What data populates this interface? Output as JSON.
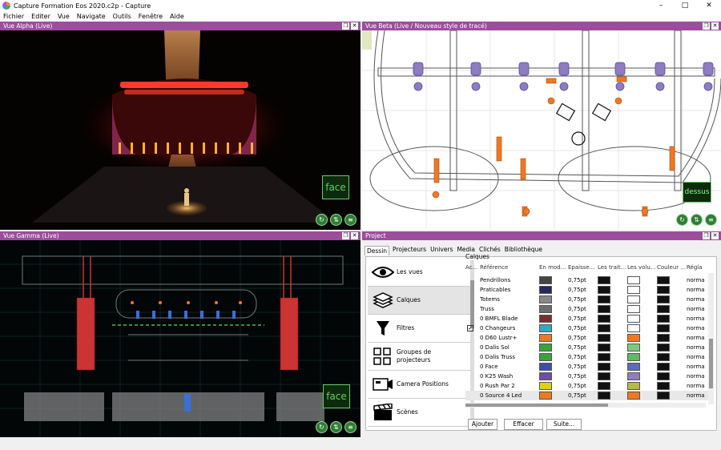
{
  "window": {
    "title": "Capture Formation Eos 2020.c2p - Capture",
    "minimize": "–",
    "maximize": "□",
    "close": "✕"
  },
  "menu": [
    "Fichier",
    "Editer",
    "Vue",
    "Navigate",
    "Outils",
    "Fenêtre",
    "Aide"
  ],
  "panes": {
    "alpha": {
      "title": "Vue Alpha  (Live)",
      "label": "face"
    },
    "beta": {
      "title": "Vue Beta  (Live / Nouveau style de tracé)",
      "label": "dessus"
    },
    "gamma": {
      "title": "Vue Gamma  (Live)",
      "label": "face"
    },
    "project": {
      "title": "Project"
    }
  },
  "pane_buttons": {
    "a": "❐",
    "b": "✕"
  },
  "view_buttons": {
    "a": "↻",
    "b": "⇅",
    "c": "≡"
  },
  "project": {
    "tabs": [
      "Dessin",
      "Projecteurs",
      "Univers",
      "Media",
      "Clichés",
      "Bibliothèque"
    ],
    "categories": [
      {
        "label": "Les vues",
        "icon": "eye-icon"
      },
      {
        "label": "Calques",
        "icon": "layers-icon"
      },
      {
        "label": "Filtres",
        "icon": "funnel-icon"
      },
      {
        "label": "Groupes de projecteurs",
        "icon": "fixture-group-icon"
      },
      {
        "label": "Camera Positions",
        "icon": "camera-icon"
      },
      {
        "label": "Scènes",
        "icon": "clapperboard-icon"
      }
    ],
    "layers_title": "Calques",
    "columns": [
      "Ac...",
      "Référence",
      "En mod...",
      "Epaisse...",
      "Les trait...",
      "Les volu...",
      "Couleur ...",
      "Régla"
    ],
    "rows": [
      {
        "name": "Pendrillons",
        "color": "#454545",
        "thickness": "0,75pt",
        "vol": "#ffffff",
        "active": false,
        "mode": "norma"
      },
      {
        "name": "Praticables",
        "color": "#262661",
        "thickness": "0,75pt",
        "vol": "#ffffff",
        "active": false,
        "mode": "norma"
      },
      {
        "name": "Totems",
        "color": "#878787",
        "thickness": "0,75pt",
        "vol": "#ffffff",
        "active": false,
        "mode": "norma"
      },
      {
        "name": "Truss",
        "color": "#6e6e6e",
        "thickness": "0,75pt",
        "vol": "#ffffff",
        "active": false,
        "mode": "norma"
      },
      {
        "name": "0 BMFL Blade",
        "color": "#7a2f2f",
        "thickness": "0,75pt",
        "vol": "#ffffff",
        "active": false,
        "mode": "norma"
      },
      {
        "name": "0 Changeurs",
        "color": "#32a9c3",
        "thickness": "0,75pt",
        "vol": "#ffffff",
        "active": true,
        "mode": "norma"
      },
      {
        "name": "0 D60 Lustr+",
        "color": "#f07823",
        "thickness": "0,75pt",
        "vol": "#f07823",
        "active": false,
        "mode": "norma"
      },
      {
        "name": "0 Dalis Sol",
        "color": "#3ba33b",
        "thickness": "0,75pt",
        "vol": "#7ec87e",
        "active": false,
        "mode": "norma"
      },
      {
        "name": "0 Dalis Truss",
        "color": "#3aa23a",
        "thickness": "0,75pt",
        "vol": "#5fba5f",
        "active": false,
        "mode": "norma"
      },
      {
        "name": "0 Face",
        "color": "#3d4fa8",
        "thickness": "0,75pt",
        "vol": "#5b6bbf",
        "active": false,
        "mode": "norma"
      },
      {
        "name": "0 K25 Wash",
        "color": "#6a4fa3",
        "thickness": "0,75pt",
        "vol": "#8f7cc1",
        "active": false,
        "mode": "norma"
      },
      {
        "name": "0 Rush Par 2",
        "color": "#e2d018",
        "thickness": "0,75pt",
        "vol": "#b5b84a",
        "active": false,
        "mode": "norma"
      },
      {
        "name": "0 Source 4 Led",
        "color": "#f07823",
        "thickness": "0,75pt",
        "vol": "#f07823",
        "active": false,
        "mode": "norma"
      }
    ],
    "buttons": {
      "add": "Ajouter",
      "delete": "Effacer",
      "next": "Suite..."
    }
  }
}
